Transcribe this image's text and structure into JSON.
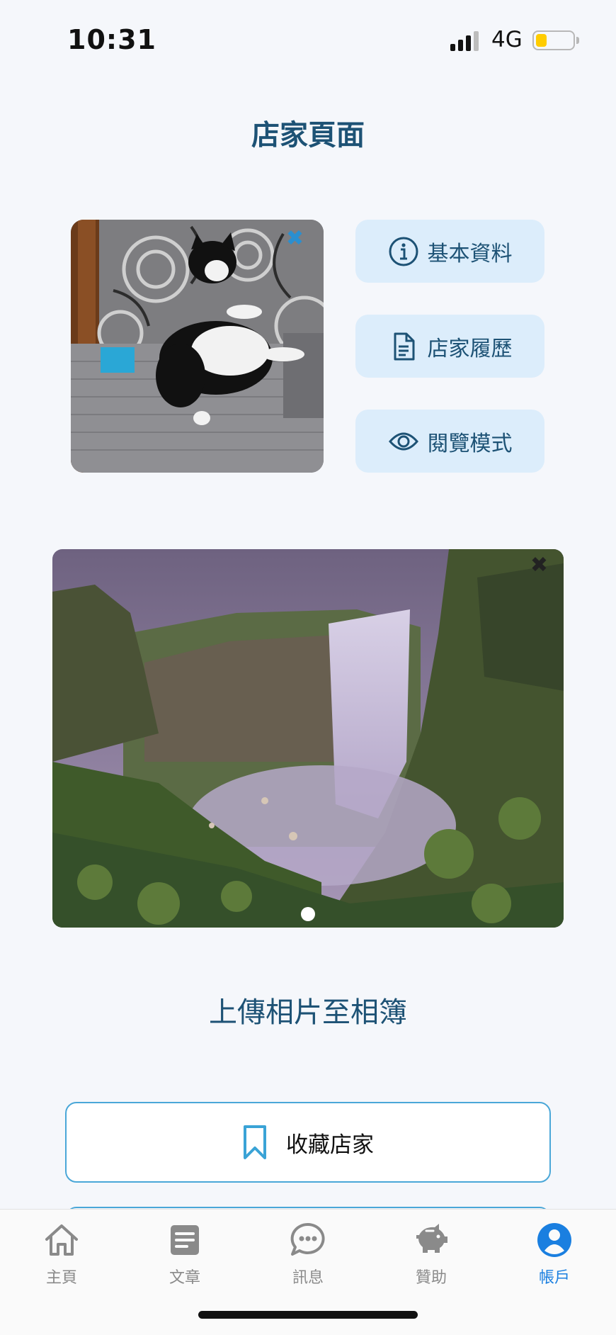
{
  "status_bar": {
    "time": "10:31",
    "network": "4G",
    "battery_level": 0.3
  },
  "page_title": "店家頁面",
  "cover": {
    "remove_icon": "close-icon"
  },
  "actions": [
    {
      "label": "基本資料",
      "icon": "info-icon"
    },
    {
      "label": "店家履歷",
      "icon": "document-icon"
    },
    {
      "label": "閱覽模式",
      "icon": "eye-icon"
    }
  ],
  "album": {
    "remove_icon": "close-icon",
    "current_page": 1,
    "total_pages": 1
  },
  "upload_label": "上傳相片至相簿",
  "favorite": {
    "label": "收藏店家",
    "icon": "bookmark-icon"
  },
  "tabs": [
    {
      "label": "主頁",
      "icon": "home-icon",
      "active": false
    },
    {
      "label": "文章",
      "icon": "article-icon",
      "active": false
    },
    {
      "label": "訊息",
      "icon": "chat-icon",
      "active": false
    },
    {
      "label": "贊助",
      "icon": "piggy-bank-icon",
      "active": false
    },
    {
      "label": "帳戶",
      "icon": "account-icon",
      "active": true
    }
  ],
  "colors": {
    "primary": "#1d5275",
    "button_bg": "#dcedfb",
    "accent": "#1a7fe0",
    "border": "#4aa7d8",
    "background": "#f5f7fb"
  }
}
